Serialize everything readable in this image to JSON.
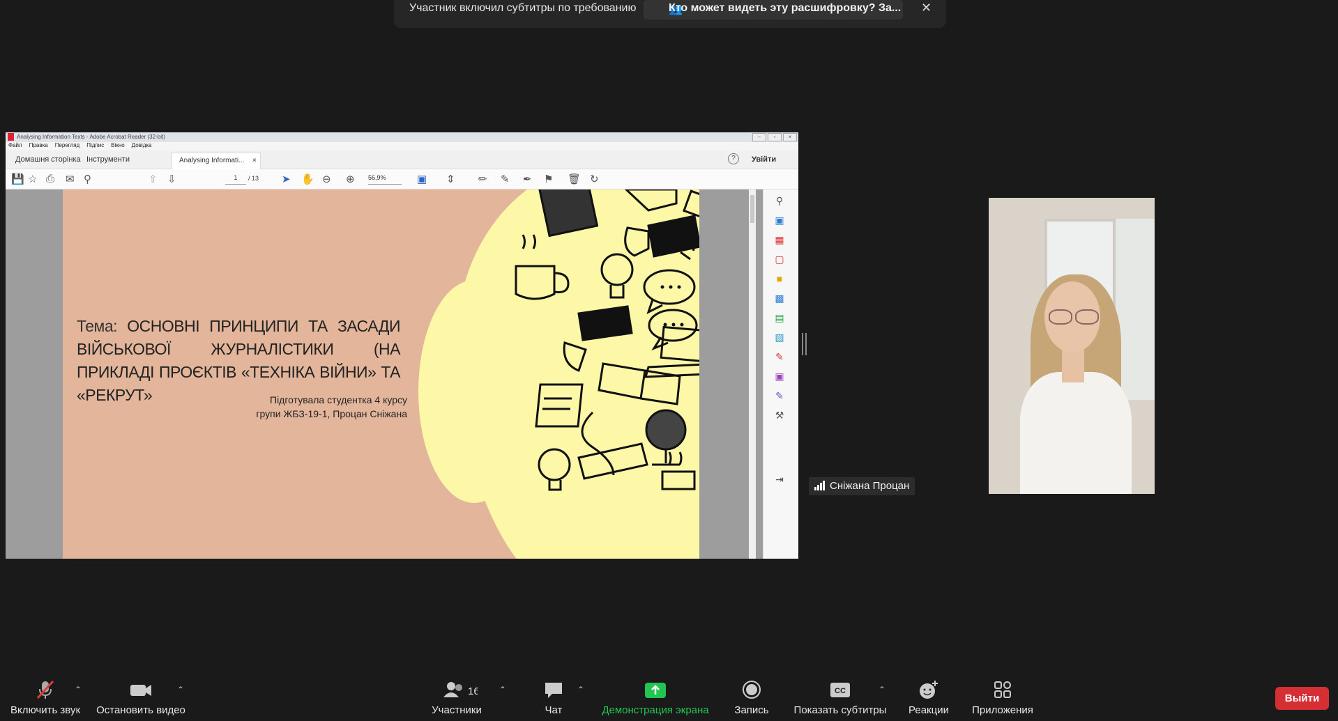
{
  "notification": {
    "message": "Участник включил субтитры по требованию",
    "who_can_see": "Кто может видеть эту расшифровку? За...",
    "close_icon": "close-icon"
  },
  "acrobat": {
    "window_title": "Analysing Information Texts - Adobe Acrobat Reader (32-bit)",
    "menu": [
      "Файл",
      "Правка",
      "Перегляд",
      "Підпис",
      "Вікно",
      "Довідка"
    ],
    "tabs": {
      "home": "Домашня сторінка",
      "tools": "Інструменти",
      "document": "Analysing Informati..."
    },
    "signin": "Увійти",
    "help": "?",
    "page_current": "1",
    "page_total": "/ 13",
    "zoom": "56,9%"
  },
  "slide": {
    "title_label": "Тема:",
    "title": "ОСНОВНІ ПРИНЦИПИ ТА ЗАСАДИ ВІЙСЬКОВОЇ ЖУРНАЛІСТИКИ (НА ПРИКЛАДІ ПРОЄКТІВ «ТЕХНІКА ВІЙНИ» ТА «РЕКРУТ»",
    "author_line1": "Підготувала студентка 4 курсу",
    "author_line2": "групи ЖБЗ-19-1, Процан Сніжана",
    "colors": {
      "left": "#e3b69b",
      "right": "#fdf7a8"
    }
  },
  "participant": {
    "name": "Сніжана Процан"
  },
  "toolbar": {
    "mute": "Включить звук",
    "video": "Остановить видео",
    "participants": "Участники",
    "participants_count": "16",
    "chat": "Чат",
    "share": "Демонстрация экрана",
    "record": "Запись",
    "captions": "Показать субтитры",
    "captions_icon_text": "CC",
    "reactions": "Реакции",
    "apps": "Приложения",
    "leave": "Выйти",
    "share_color": "#23c552",
    "leave_color": "#d52e33"
  }
}
